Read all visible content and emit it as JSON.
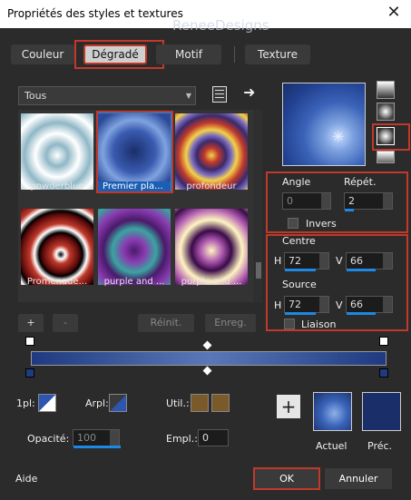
{
  "window": {
    "title": "Propriétés des styles et textures",
    "watermark": "ReneeDesigns"
  },
  "tabs": [
    {
      "label": "Couleur",
      "active": false
    },
    {
      "label": "Dégradé",
      "active": true
    },
    {
      "label": "Motif",
      "active": false
    },
    {
      "label": "Texture",
      "active": false
    }
  ],
  "category": {
    "selected": "Tous"
  },
  "gallery": [
    {
      "name": "powderblue",
      "selected": false
    },
    {
      "name": "Premier pla...",
      "selected": true
    },
    {
      "name": "profondeur",
      "selected": false
    },
    {
      "name": "Promenade...",
      "selected": false
    },
    {
      "name": "purple and ...",
      "selected": false
    },
    {
      "name": "purple and ...",
      "selected": false
    }
  ],
  "list_buttons": {
    "add": "+",
    "remove": "-",
    "reset": "Réinit.",
    "save": "Enreg."
  },
  "angle": {
    "label": "Angle",
    "value": "0"
  },
  "repeat": {
    "label": "Répét.",
    "value": "2"
  },
  "invert": {
    "label": "Invers",
    "checked": false
  },
  "center": {
    "label": "Centre",
    "h_label": "H",
    "h": "72",
    "v_label": "V",
    "v": "66"
  },
  "source": {
    "label": "Source",
    "h_label": "H",
    "h": "72",
    "v_label": "V",
    "v": "66"
  },
  "link": {
    "label": "Liaison",
    "checked": false
  },
  "bottom": {
    "fg_label": "1pl:",
    "arpl_label": "Arpl:",
    "util_label": "Util.:",
    "opacity_label": "Opacité:",
    "opacity_value": "100",
    "empl_label": "Empl.:",
    "empl_value": "0",
    "current_label": "Actuel",
    "previous_label": "Préc.",
    "add_symbol": "+"
  },
  "footer": {
    "help": "Aide",
    "ok": "OK",
    "cancel": "Annuler"
  },
  "colors": {
    "accent": "#1e88e5",
    "highlight": "#c0392b",
    "util": "#7a5a28",
    "current": "#2e56b0",
    "previous": "#1a2f6a"
  }
}
